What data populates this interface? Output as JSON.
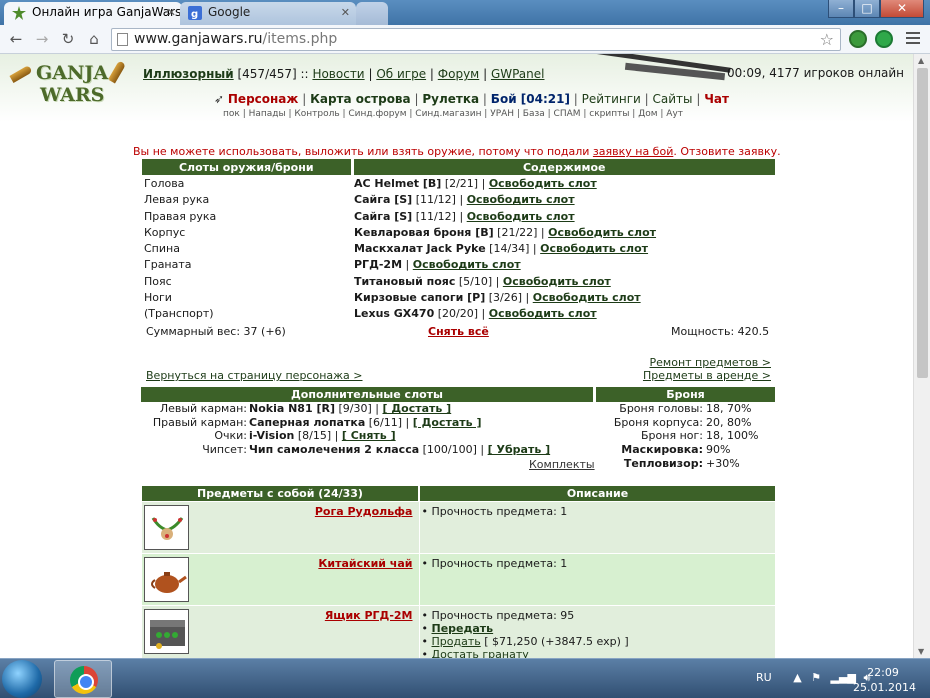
{
  "browser": {
    "tabs": [
      {
        "title": "Онлайн игра GanjaWars.r"
      },
      {
        "title": "Google"
      }
    ],
    "url_host": "www.ganjawars.ru",
    "url_path": "/items.php"
  },
  "header": {
    "logo_line1": "GANJA",
    "logo_line2": "WARS",
    "nick": "Иллюзорный",
    "hp": "[457/457] ::",
    "links": [
      "Новости",
      "Об игре",
      "Форум",
      "GWPanel"
    ],
    "link_sep": "|",
    "online": "00:09, 4177 игроков онлайн",
    "menu": {
      "personazh": "Персонаж",
      "karta": "Карта острова",
      "ruletka": "Рулетка",
      "boj": "Бой [04:21]",
      "rejtingi": "Рейтинги",
      "sajty": "Сайты",
      "chat": "Чат"
    },
    "submenu": "пок | Напады | Контроль | Синд.форум | Синд.магазин | УРАН | База | СПАМ | скрипты | Дом | Аут"
  },
  "warning": {
    "before": "Вы не можете использовать, выложить или взять оружие, потому что подали ",
    "link": "заявку на бой",
    "after": ". Отзовите заявку."
  },
  "slots": {
    "header_slots": "Слоты оружия/брони",
    "header_content": "Содержимое",
    "release": "Освободить слот",
    "rows": [
      {
        "slot": "Голова",
        "item": "AC Helmet [B]",
        "dur": "[2/21] |"
      },
      {
        "slot": "Левая рука",
        "item": "Сайга [S]",
        "dur": "[11/12] |"
      },
      {
        "slot": "Правая рука",
        "item": "Сайга [S]",
        "dur": "[11/12] |"
      },
      {
        "slot": "Корпус",
        "item": "Кевларовая броня [B]",
        "dur": "[21/22] |"
      },
      {
        "slot": "Спина",
        "item": "Маскхалат Jack Pyke",
        "dur": "[14/34] |"
      },
      {
        "slot": "Граната",
        "item": "РГД-2М",
        "dur": " |"
      },
      {
        "slot": "Пояс",
        "item": "Титановый пояс",
        "dur": "[5/10] |"
      },
      {
        "slot": "Ноги",
        "item": "Кирзовые сапоги [P]",
        "dur": "[3/26] |"
      },
      {
        "slot": "(Транспорт)",
        "item": "Lexus GX470",
        "dur": "[20/20] |"
      }
    ],
    "weight": "Суммарный вес: 37 (+6)",
    "takeoff": "Снять всё",
    "power": "Мощность: 420.5"
  },
  "links": {
    "repair": "Ремонт предметов >",
    "rented": "Предметы в аренде >",
    "back": "Вернуться на страницу персонажа >"
  },
  "extra": {
    "header": "Дополнительные слоты",
    "rows": [
      {
        "label": "Левый карман:",
        "item": "Nokia N81 [R]",
        "dur": "[9/30] |",
        "action": "[ Достать ]"
      },
      {
        "label": "Правый карман:",
        "item": "Саперная лопатка",
        "dur": "[6/11] |",
        "action": "[ Достать ]"
      },
      {
        "label": "Очки:",
        "item": "i-Vision",
        "dur": "[8/15] |",
        "action": "[ Снять ]"
      },
      {
        "label": "Чипсет:",
        "item": "Чип самолечения 2 класса",
        "dur": "[100/100] |",
        "action": "[ Убрать ]"
      }
    ],
    "kits": "Комплекты"
  },
  "armor": {
    "header": "Броня",
    "rows": [
      {
        "label": "Броня головы:",
        "value": "18, 70%"
      },
      {
        "label": "Броня корпуса:",
        "value": "20, 80%"
      },
      {
        "label": "Броня ног:",
        "value": "18, 100%"
      },
      {
        "label": "Маскировка:",
        "value": "90%"
      },
      {
        "label": "Тепловизор:",
        "value": "+30%"
      }
    ]
  },
  "items": {
    "header_items": "Предметы с собой (24/33)",
    "header_desc": "Описание",
    "rows": [
      {
        "name": "Рога Рудольфа",
        "durability": "Прочность предмета: 1",
        "icon": "antlers-icon"
      },
      {
        "name": "Китайский чай",
        "durability": "Прочность предмета: 1",
        "icon": "teapot-icon"
      },
      {
        "name": "Ящик РГД-2М",
        "durability": "Прочность предмета: 95",
        "icon": "grenade-box-icon",
        "actions": [
          "Передать",
          "Продать"
        ],
        "price": " [ $71,250 (+3847.5 exp) ]",
        "extra": "Достать гранату"
      }
    ]
  },
  "taskbar": {
    "lang": "RU",
    "time": "22:09",
    "date": "25.01.2014"
  }
}
